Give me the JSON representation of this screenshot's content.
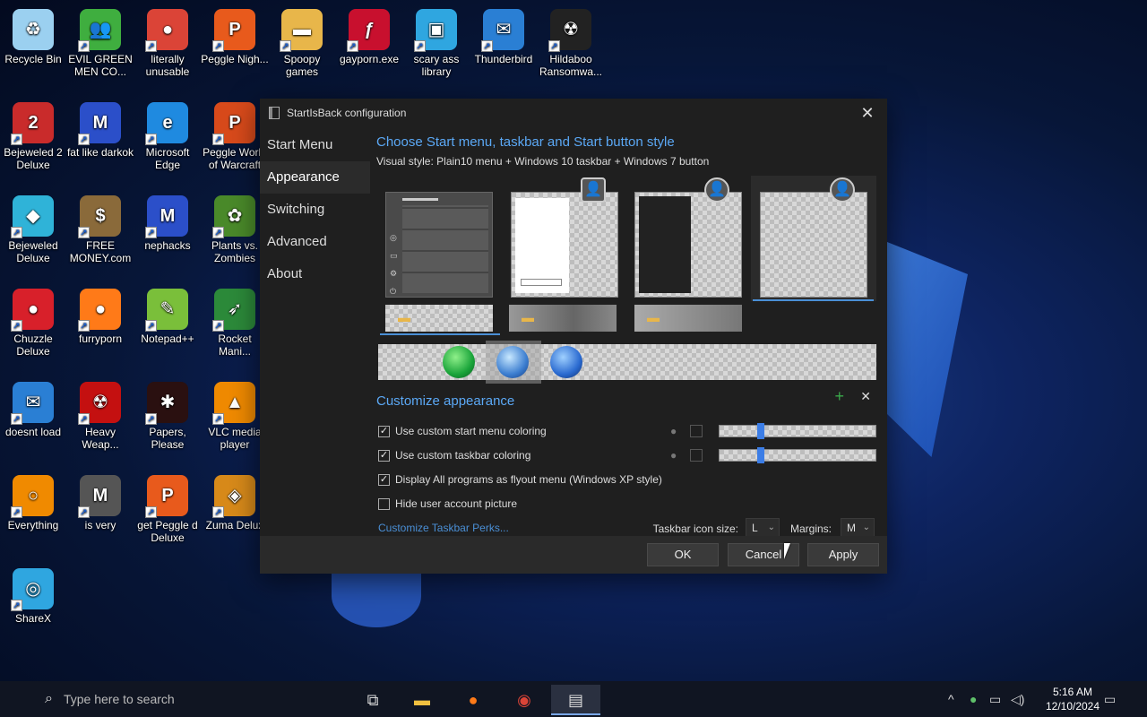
{
  "desktop": {
    "icons": [
      {
        "label": "Recycle Bin",
        "icon": "recycle-bin-icon",
        "color": "#9bd0f0",
        "glyph": "♻"
      },
      {
        "label": "EVIL GREEN MEN CO...",
        "icon": "green-men-icon",
        "color": "#3fae3f",
        "glyph": "👥"
      },
      {
        "label": "literally unusable",
        "icon": "chrome-icon",
        "color": "#db4437",
        "glyph": "●"
      },
      {
        "label": "Peggle Nigh...",
        "icon": "peggle-icon",
        "color": "#e85a1c",
        "glyph": "P"
      },
      {
        "label": "Spoopy games",
        "icon": "folder-icon",
        "color": "#e8b64a",
        "glyph": "▬"
      },
      {
        "label": "gayporn.exe",
        "icon": "flash-icon",
        "color": "#c8102e",
        "glyph": "ƒ"
      },
      {
        "label": "scary ass library",
        "icon": "network-icon",
        "color": "#2fa6e0",
        "glyph": "▣"
      },
      {
        "label": "Thunderbird",
        "icon": "thunderbird-icon",
        "color": "#2a7fd4",
        "glyph": "✉"
      },
      {
        "label": "Hildaboo Ransomwa...",
        "icon": "ransomware-icon",
        "color": "#222222",
        "glyph": "☢"
      },
      {
        "label": "Bejeweled 2 Deluxe",
        "icon": "bejeweled2-icon",
        "color": "#c92b2b",
        "glyph": "2"
      },
      {
        "label": "fat like darkok",
        "icon": "mpi-icon",
        "color": "#2b4fc9",
        "glyph": "M"
      },
      {
        "label": "Microsoft Edge",
        "icon": "edge-icon",
        "color": "#1f8ae0",
        "glyph": "e"
      },
      {
        "label": "Peggle World of Warcraft",
        "icon": "peggle-wow-icon",
        "color": "#d84a1b",
        "glyph": "P"
      },
      {
        "label": "Bejeweled Deluxe",
        "icon": "bejeweled-icon",
        "color": "#2fb3d8",
        "glyph": "◆"
      },
      {
        "label": "FREE MONEY.com",
        "icon": "money-bag-icon",
        "color": "#8a6a3a",
        "glyph": "$"
      },
      {
        "label": "nephacks",
        "icon": "mpi-icon",
        "color": "#2b4fc9",
        "glyph": "M"
      },
      {
        "label": "Plants vs. Zombies",
        "icon": "pvz-icon",
        "color": "#4a8a2a",
        "glyph": "✿"
      },
      {
        "label": "Chuzzle Deluxe",
        "icon": "chuzzle-icon",
        "color": "#d8202a",
        "glyph": "●"
      },
      {
        "label": "furryporn",
        "icon": "firefox-icon",
        "color": "#ff7a18",
        "glyph": "●"
      },
      {
        "label": "Notepad++",
        "icon": "notepadpp-icon",
        "color": "#7abf3a",
        "glyph": "✎"
      },
      {
        "label": "Rocket Mani...",
        "icon": "rocket-icon",
        "color": "#2c8a3a",
        "glyph": "➶"
      },
      {
        "label": "doesnt load",
        "icon": "thunderbird-icon",
        "color": "#2a7fd4",
        "glyph": "✉"
      },
      {
        "label": "Heavy Weap...",
        "icon": "radiation-icon",
        "color": "#c41010",
        "glyph": "☢"
      },
      {
        "label": "Papers, Please",
        "icon": "papers-please-icon",
        "color": "#2a1010",
        "glyph": "✱"
      },
      {
        "label": "VLC media player",
        "icon": "vlc-icon",
        "color": "#f08a00",
        "glyph": "▲"
      },
      {
        "label": "Everything",
        "icon": "search-icon",
        "color": "#f08a00",
        "glyph": "○"
      },
      {
        "label": "is very",
        "icon": "mpi-shield-icon",
        "color": "#555555",
        "glyph": "M"
      },
      {
        "label": "get Peggle d Deluxe",
        "icon": "peggle-icon",
        "color": "#e85a1c",
        "glyph": "P"
      },
      {
        "label": "Zuma Delux",
        "icon": "zuma-icon",
        "color": "#d88a1a",
        "glyph": "◈"
      },
      {
        "label": "ShareX",
        "icon": "sharex-icon",
        "color": "#2fa6e0",
        "glyph": "◎"
      }
    ]
  },
  "window": {
    "title": "StartIsBack configuration",
    "nav": [
      "Start Menu",
      "Appearance",
      "Switching",
      "Advanced",
      "About"
    ],
    "selected_nav": "Appearance",
    "heading": "Choose Start menu, taskbar and Start button style",
    "visual_style": "Visual style:  Plain10 menu + Windows 10 taskbar + Windows 7 button",
    "customize_heading": "Customize appearance",
    "options": [
      {
        "label": "Use custom start menu coloring",
        "checked": true
      },
      {
        "label": "Use custom taskbar coloring",
        "checked": true
      },
      {
        "label": "Display All programs as flyout menu (Windows XP style)",
        "checked": true
      },
      {
        "label": "Hide user account picture",
        "checked": false
      }
    ],
    "link": "Customize Taskbar Perks...",
    "icon_size_label": "Taskbar icon size:",
    "icon_size_value": "L",
    "margins_label": "Margins:",
    "margins_value": "M",
    "buttons": {
      "ok": "OK",
      "cancel": "Cancel",
      "apply": "Apply"
    },
    "sliders": [
      0.25,
      0.25
    ]
  },
  "taskbar": {
    "search_placeholder": "Type here to search",
    "time": "5:16 AM",
    "date": "12/10/2024"
  }
}
